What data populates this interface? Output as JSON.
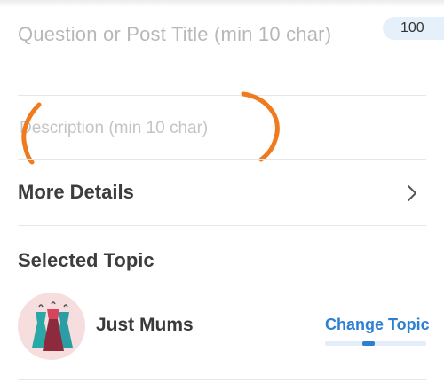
{
  "form": {
    "title_placeholder": "Question or Post Title (min 10 char)",
    "title_counter": "100",
    "description_placeholder": "Description (min 10 char)"
  },
  "more_details": {
    "label": "More Details",
    "icon": "chevron-right-icon"
  },
  "selected_topic": {
    "heading": "Selected Topic",
    "topic_name": "Just Mums",
    "change_label": "Change Topic",
    "avatar_icon": "dresses-icon"
  },
  "colors": {
    "accent": "#2d7fd0",
    "annotation": "#f07a1e",
    "placeholder": "#b8b8b8"
  }
}
